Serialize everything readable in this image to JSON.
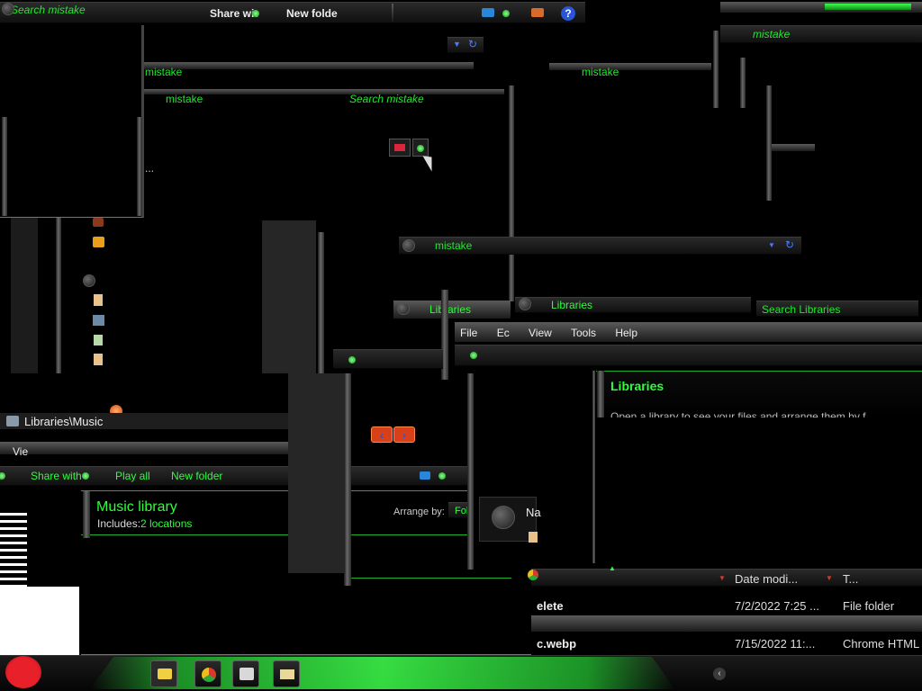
{
  "top_search_1": "Search mistake",
  "top_share": "Share wit",
  "top_newfolder": "New folde",
  "search_a": "mistake",
  "search_b": "mistake",
  "search_c": "Search mistake",
  "search_top_right": "mistake",
  "search_right": "mistake",
  "search_mid": "mistake",
  "ellipsis": "...",
  "win2": {
    "address": "Libraries",
    "title": "Libraries",
    "search": "Search Libraries",
    "menu": [
      "File",
      "Ec",
      "View",
      "Tools",
      "Help"
    ],
    "heading": "Libraries",
    "subtext": "Open a library to see your files and arrange them by f",
    "columns": {
      "date": "Date modi...",
      "type": "T..."
    },
    "rows": [
      {
        "name": "elete",
        "date": "7/2/2022 7:25 ...",
        "type": "File folder"
      },
      {
        "name": "c.webp",
        "date": "7/15/2022 11:...",
        "type": "Chrome HTML"
      }
    ]
  },
  "music": {
    "address": "Libraries\\Music",
    "view_label": "Vie",
    "toolbar": {
      "share": "Share with",
      "play": "Play all",
      "newfolder": "New folder"
    },
    "title": "Music library",
    "includes_label": "Includes:",
    "includes_value": "2 locations",
    "arrange_label": "Arrange by:",
    "arrange_value": "Fol",
    "na_stub": "Na"
  },
  "colors": {
    "accent": "#22e82e",
    "bg": "#000000",
    "chrome": "#2a2a2a"
  },
  "icons": [
    "angry-bird-start-icon",
    "explorer-folder-icon",
    "chrome-icon",
    "media-player-icon",
    "printer-icon",
    "help-icon",
    "refresh-icon",
    "back-forward-icon"
  ]
}
